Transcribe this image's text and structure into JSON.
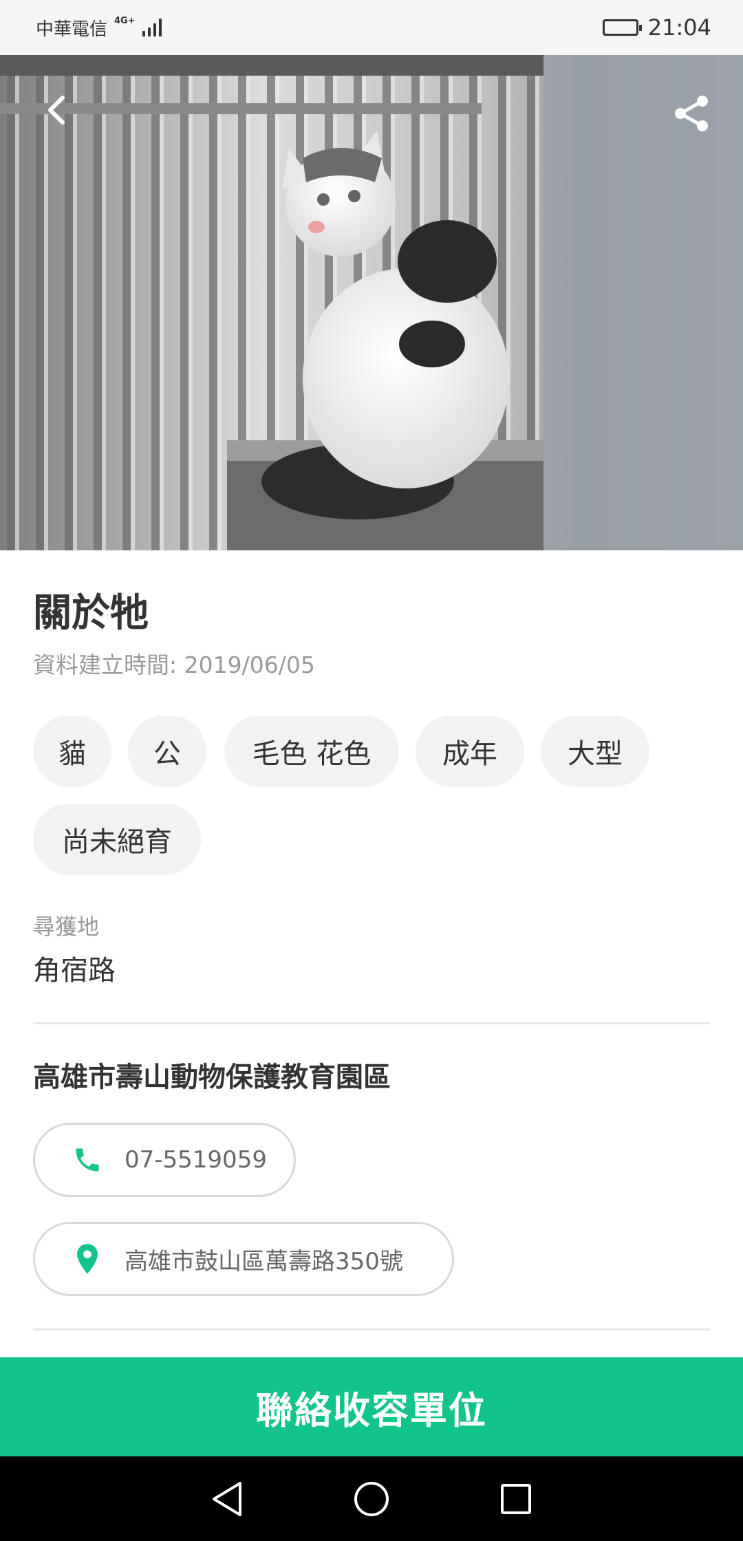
{
  "status_bar": {
    "carrier": "中華電信",
    "network": "4G+",
    "time": "21:04",
    "icons": [
      "signal-icon",
      "battery-icon"
    ]
  },
  "hero": {
    "image": "cat-photo",
    "back_icon": "chevron-left-icon",
    "share_icon": "share-icon"
  },
  "about": {
    "title": "關於牠",
    "created": "資料建立時間: 2019/06/05"
  },
  "tags": [
    "貓",
    "公",
    "毛色 花色",
    "成年",
    "大型",
    "尚未絕育"
  ],
  "location": {
    "label": "尋獲地",
    "value": "角宿路"
  },
  "shelter": {
    "name": "高雄市壽山動物保護教育園區",
    "phone": "07-5519059",
    "phone_icon": "phone-icon",
    "address": "高雄市鼓山區萬壽路350號",
    "address_icon": "map-pin-icon"
  },
  "cta": {
    "label": "聯絡收容單位"
  },
  "nav": {
    "icons": [
      "nav-back-icon",
      "nav-home-icon",
      "nav-recents-icon"
    ]
  },
  "colors": {
    "accent": "#12c48b",
    "chip_bg": "#f2f2f2",
    "muted_text": "#999999"
  }
}
